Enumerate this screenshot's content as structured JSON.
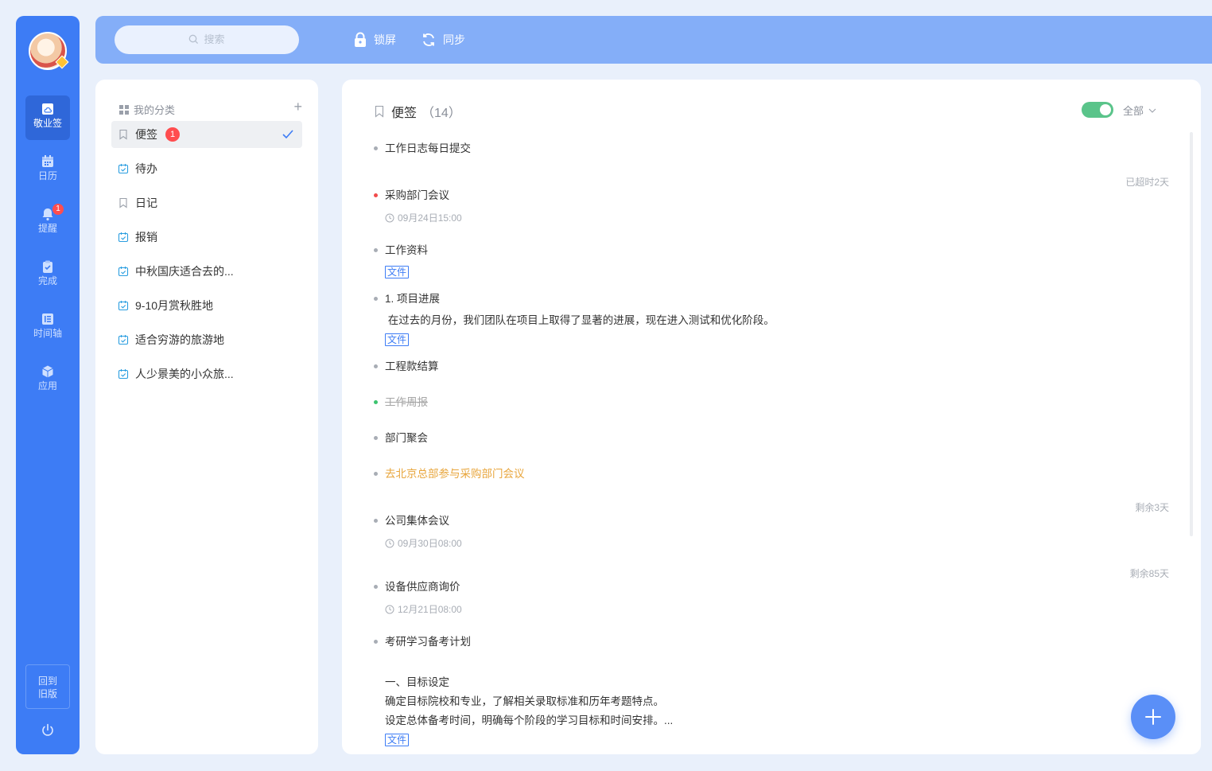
{
  "nav": {
    "items": [
      {
        "label": "敬业签",
        "icon": "cloud-note-icon",
        "active": true
      },
      {
        "label": "日历",
        "icon": "calendar-icon"
      },
      {
        "label": "提醒",
        "icon": "bell-icon",
        "badge": "1"
      },
      {
        "label": "完成",
        "icon": "clipboard-check-icon"
      },
      {
        "label": "时间轴",
        "icon": "timeline-icon"
      },
      {
        "label": "应用",
        "icon": "cube-icon"
      }
    ],
    "back_old": "回到旧版"
  },
  "topbar": {
    "search_placeholder": "搜索",
    "lock_label": "锁屏",
    "sync_label": "同步"
  },
  "categories": {
    "header": "我的分类",
    "items": [
      {
        "label": "便签",
        "icon": "bookmark-icon",
        "badge": "1",
        "selected": true
      },
      {
        "label": "待办",
        "icon": "todo-icon"
      },
      {
        "label": "日记",
        "icon": "bookmark-icon"
      },
      {
        "label": "报销",
        "icon": "todo-icon"
      },
      {
        "label": "中秋国庆适合去的...",
        "icon": "todo-icon"
      },
      {
        "label": "9-10月赏秋胜地",
        "icon": "todo-icon"
      },
      {
        "label": "适合穷游的旅游地",
        "icon": "todo-icon"
      },
      {
        "label": "人少景美的小众旅...",
        "icon": "todo-icon"
      }
    ]
  },
  "main": {
    "title": "便签",
    "count": "（14）",
    "filter": "全部",
    "notes": [
      {
        "title": "工作日志每日提交"
      },
      {
        "status": "已超时2天",
        "title": "采购部门会议",
        "time": "09月24日15:00",
        "dot": "red"
      },
      {
        "title": "工作资料",
        "file": "文件"
      },
      {
        "title": "1. 项目进展",
        "body": " 在过去的月份，我们团队在项目上取得了显著的进展，现在进入测试和优化阶段。",
        "file": "文件"
      },
      {
        "title": "工程款结算"
      },
      {
        "title": "工作周报",
        "dot": "green",
        "done": true
      },
      {
        "title": "部门聚会"
      },
      {
        "title": "去北京总部参与采购部门会议",
        "highlight": true
      },
      {
        "status": "剩余3天",
        "title": "公司集体会议",
        "time": "09月30日08:00"
      },
      {
        "status": "剩余85天",
        "title": "设备供应商询价",
        "time": "12月21日08:00"
      },
      {
        "title": "考研学习备考计划",
        "body_lines": [
          "",
          "一、目标设定",
          "确定目标院校和专业，了解相关录取标准和历年考题特点。",
          "设定总体备考时间，明确每个阶段的学习目标和时间安排。..."
        ],
        "file": "文件"
      }
    ]
  },
  "colors": {
    "rail": "#3d7cf5",
    "topbar": "#84aef8",
    "toggle_on": "#5ac48a",
    "badge": "#ff4d4f",
    "warn_text": "#e8a53b"
  }
}
